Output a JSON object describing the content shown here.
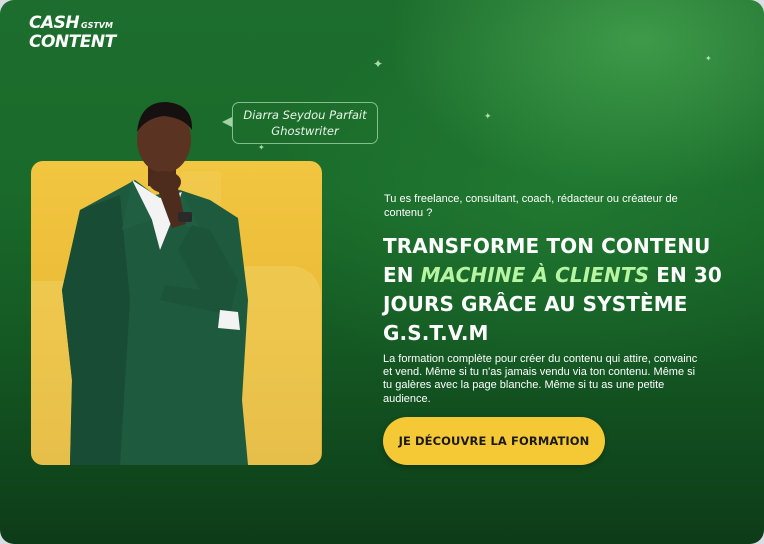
{
  "brand": {
    "line1": "CASH",
    "badge": "GSTVM",
    "line2": "CONTENT"
  },
  "author_tag": {
    "name": "Diarra Seydou Parfait",
    "role": "Ghostwriter"
  },
  "hero": {
    "eyebrow": "Tu es freelance, consultant, coach, rédacteur ou créateur de contenu ?",
    "headline_part1": "TRANSFORME TON CONTENU EN ",
    "headline_highlight": "MACHINE À CLIENTS",
    "headline_part2": " EN 30 JOURS GRÂCE AU SYSTÈME G.S.T.V.M",
    "description": "La formation complète pour créer du contenu qui attire, convainc et vend. Même si tu n'as jamais vendu via ton contenu. Même si tu galères avec la page blanche. Même si tu as une petite audience.",
    "cta_label": "JE DÉCOUVRE LA FORMATION"
  },
  "colors": {
    "accent": "#f5c836",
    "highlight": "#b8f5a2",
    "background": "#1a6a2b"
  },
  "icons": [
    "sparkle-icon",
    "speech-pointer-icon"
  ]
}
